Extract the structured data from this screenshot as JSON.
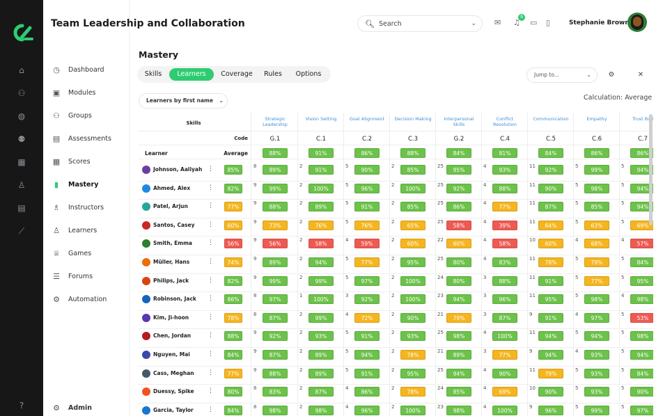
{
  "app": {
    "title": "Team Leadership and Collaboration",
    "accent": "#2ecc71"
  },
  "header": {
    "search_placeholder": "Search",
    "user_name": "Stephanie Brown",
    "notification_count": "9"
  },
  "sidebar": {
    "items": [
      {
        "label": "Dashboard",
        "icon": "clock-icon"
      },
      {
        "label": "Modules",
        "icon": "book-icon"
      },
      {
        "label": "Groups",
        "icon": "group-icon"
      },
      {
        "label": "Assessments",
        "icon": "document-icon"
      },
      {
        "label": "Scores",
        "icon": "table-icon"
      },
      {
        "label": "Mastery",
        "icon": "bar-chart-icon",
        "active": true
      },
      {
        "label": "Instructors",
        "icon": "instructor-icon"
      },
      {
        "label": "Learners",
        "icon": "user-icon"
      },
      {
        "label": "Games",
        "icon": "trophy-icon"
      },
      {
        "label": "Forums",
        "icon": "list-icon"
      },
      {
        "label": "Automation",
        "icon": "gears-icon"
      }
    ],
    "admin_label": "Admin"
  },
  "page": {
    "title": "Mastery",
    "tabs": [
      "Skills",
      "Learners",
      "Coverage",
      "Rules",
      "Options"
    ],
    "active_tab": "Learners",
    "jump_placeholder": "Jump to...",
    "sort_label": "Learners by first name",
    "calculation_label": "Calculation: Average"
  },
  "table": {
    "header_skills": "Skills",
    "header_code": "Code",
    "header_learner": "Learner",
    "header_average": "Average",
    "skills": [
      {
        "name": "Strategic Leadership",
        "code": "G.1",
        "avg": "88%"
      },
      {
        "name": "Vision Setting",
        "code": "C.1",
        "avg": "91%"
      },
      {
        "name": "Goal Alignment",
        "code": "C.2",
        "avg": "86%"
      },
      {
        "name": "Decision Making",
        "code": "C.3",
        "avg": "88%"
      },
      {
        "name": "Interpersonal Skills",
        "code": "G.2",
        "avg": "84%"
      },
      {
        "name": "Conflict Resolution",
        "code": "C.4",
        "avg": "81%"
      },
      {
        "name": "Communication",
        "code": "C.5",
        "avg": "84%"
      },
      {
        "name": "Empathy",
        "code": "C.6",
        "avg": "86%"
      },
      {
        "name": "Trust Buil",
        "code": "C.7",
        "avg": "86%"
      }
    ],
    "counts": [
      8,
      2,
      5,
      2,
      25,
      4,
      11,
      5,
      5
    ],
    "rows": [
      {
        "name": "Johnson, Aaliyah",
        "avg": "85%",
        "scores": [
          "89%",
          "91%",
          "90%",
          "85%",
          "95%",
          "93%",
          "92%",
          "99%",
          "94%"
        ]
      },
      {
        "name": "Ahmed, Alex",
        "avg": "82%",
        "scores": [
          "99%",
          "100%",
          "96%",
          "100%",
          "92%",
          "88%",
          "90%",
          "98%",
          "94%"
        ]
      },
      {
        "name": "Patel, Arjun",
        "avg": "77%",
        "scores": [
          "88%",
          "89%",
          "91%",
          "85%",
          "86%",
          "77%",
          "87%",
          "85%",
          "94%"
        ]
      },
      {
        "name": "Santos, Casey",
        "avg": "60%",
        "scores": [
          "73%",
          "76%",
          "76%",
          "65%",
          "58%",
          "39%",
          "64%",
          "63%",
          "69%"
        ]
      },
      {
        "name": "Smith, Emma",
        "avg": "56%",
        "scores": [
          "56%",
          "58%",
          "59%",
          "60%",
          "60%",
          "58%",
          "60%",
          "68%",
          "57%"
        ]
      },
      {
        "name": "Müller, Hans",
        "avg": "74%",
        "scores": [
          "89%",
          "94%",
          "77%",
          "95%",
          "80%",
          "83%",
          "78%",
          "79%",
          "84%"
        ]
      },
      {
        "name": "Philips, Jack",
        "avg": "82%",
        "scores": [
          "99%",
          "99%",
          "97%",
          "100%",
          "80%",
          "88%",
          "91%",
          "77%",
          "95%"
        ]
      },
      {
        "name": "Robinson, Jack",
        "avg": "86%",
        "scores": [
          "97%",
          "100%",
          "92%",
          "100%",
          "94%",
          "96%",
          "95%",
          "98%",
          "98%"
        ]
      },
      {
        "name": "Kim, Ji-hoon",
        "avg": "78%",
        "scores": [
          "87%",
          "99%",
          "72%",
          "90%",
          "79%",
          "87%",
          "91%",
          "97%",
          "53%"
        ]
      },
      {
        "name": "Chen, Jordan",
        "avg": "88%",
        "scores": [
          "92%",
          "93%",
          "91%",
          "93%",
          "98%",
          "100%",
          "94%",
          "94%",
          "98%"
        ]
      },
      {
        "name": "Nguyen, Mai",
        "avg": "84%",
        "scores": [
          "87%",
          "89%",
          "94%",
          "78%",
          "89%",
          "77%",
          "94%",
          "93%",
          "94%"
        ]
      },
      {
        "name": "Cass, Meghan",
        "avg": "77%",
        "scores": [
          "88%",
          "89%",
          "91%",
          "95%",
          "94%",
          "90%",
          "79%",
          "93%",
          "84%"
        ]
      },
      {
        "name": "Duessy, Spike",
        "avg": "80%",
        "scores": [
          "83%",
          "87%",
          "86%",
          "78%",
          "85%",
          "69%",
          "90%",
          "93%",
          "90%"
        ]
      },
      {
        "name": "Garcia, Taylor",
        "avg": "84%",
        "scores": [
          "98%",
          "98%",
          "96%",
          "100%",
          "98%",
          "100%",
          "96%",
          "99%",
          "97%"
        ]
      }
    ],
    "row_counts": [
      [
        8,
        2,
        5,
        2,
        25,
        4,
        11,
        5,
        5
      ],
      [
        9,
        2,
        5,
        2,
        25,
        4,
        11,
        5,
        5
      ],
      [
        9,
        2,
        5,
        2,
        25,
        4,
        11,
        5,
        5
      ],
      [
        9,
        2,
        5,
        2,
        25,
        4,
        11,
        5,
        5
      ],
      [
        9,
        2,
        4,
        2,
        22,
        4,
        10,
        4,
        4
      ],
      [
        9,
        2,
        5,
        2,
        25,
        4,
        11,
        5,
        5
      ],
      [
        9,
        2,
        5,
        2,
        24,
        3,
        11,
        5,
        5
      ],
      [
        8,
        1,
        3,
        2,
        23,
        3,
        11,
        5,
        4
      ],
      [
        8,
        2,
        4,
        2,
        21,
        3,
        9,
        4,
        5
      ],
      [
        9,
        2,
        5,
        2,
        25,
        4,
        11,
        5,
        5
      ],
      [
        9,
        2,
        5,
        2,
        21,
        3,
        9,
        4,
        5
      ],
      [
        9,
        2,
        5,
        2,
        25,
        4,
        11,
        5,
        5
      ],
      [
        8,
        2,
        4,
        2,
        24,
        4,
        10,
        5,
        5
      ],
      [
        8,
        2,
        4,
        2,
        23,
        4,
        9,
        5,
        5
      ]
    ]
  }
}
